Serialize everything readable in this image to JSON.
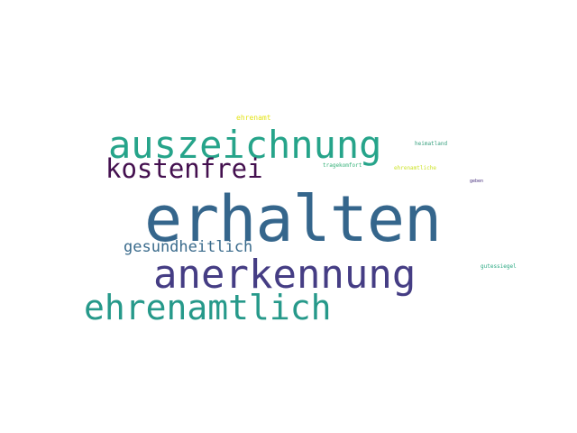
{
  "word_cloud": {
    "background": "#ffffff",
    "words": [
      {
        "text": "erhalten",
        "color": "#35668c"
      },
      {
        "text": "anerkennung",
        "color": "#453d84"
      },
      {
        "text": "auszeichnung",
        "color": "#26a48a"
      },
      {
        "text": "ehrenamtlich",
        "color": "#26998a"
      },
      {
        "text": "kostenfrei",
        "color": "#44104f"
      },
      {
        "text": "gesundheitlich",
        "color": "#3a6b8c"
      },
      {
        "text": "ehrenamt",
        "color": "#e4e419"
      },
      {
        "text": "heimatland",
        "color": "#38a07f"
      },
      {
        "text": "tragekomfort",
        "color": "#34b178"
      },
      {
        "text": "ehrenamtliche",
        "color": "#cde32a"
      },
      {
        "text": "geben",
        "color": "#472f7d"
      },
      {
        "text": "gutessiegel",
        "color": "#2aa882"
      }
    ]
  }
}
